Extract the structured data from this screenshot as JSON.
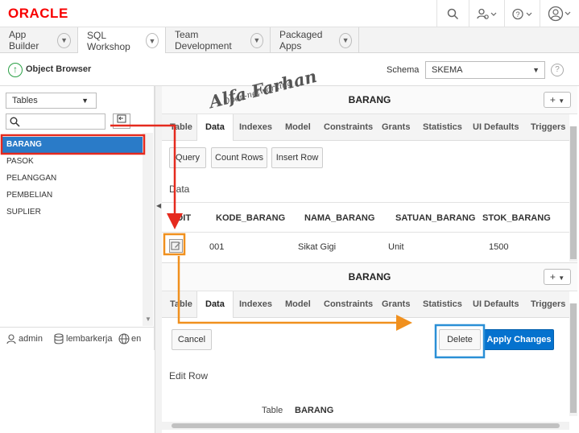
{
  "header": {
    "logo": "ORACLE",
    "icons": [
      "search-icon",
      "user-settings-icon",
      "help-icon",
      "account-icon"
    ]
  },
  "app_tabs": [
    {
      "label": "App Builder",
      "active": false
    },
    {
      "label": "SQL Workshop",
      "active": true
    },
    {
      "label": "Team Development",
      "active": false
    },
    {
      "label": "Packaged Apps",
      "active": false
    }
  ],
  "object_browser": {
    "title": "Object Browser",
    "schema_label": "Schema",
    "schema_value": "SKEMA"
  },
  "left_panel": {
    "object_type": "Tables",
    "search_placeholder": "",
    "tables": [
      "BARANG",
      "PASOK",
      "PELANGGAN",
      "PEMBELIAN",
      "SUPLIER"
    ],
    "selected": "BARANG"
  },
  "footer": {
    "user": "admin",
    "workspace": "lembarkerja",
    "language": "en"
  },
  "watermark": {
    "name": "Alfa Farhan",
    "sub": "Open-networking"
  },
  "top_panel": {
    "title": "BARANG",
    "add_label": "+",
    "tabs": [
      "Table",
      "Data",
      "Indexes",
      "Model",
      "Constraints",
      "Grants",
      "Statistics",
      "UI Defaults",
      "Triggers"
    ],
    "active_tab": "Data",
    "buttons": [
      "Query",
      "Count Rows",
      "Insert Row"
    ],
    "section_label": "Data",
    "columns": [
      "EDIT",
      "KODE_BARANG",
      "NAMA_BARANG",
      "SATUAN_BARANG",
      "STOK_BARANG"
    ],
    "rows": [
      {
        "kode": "001",
        "nama": "Sikat Gigi",
        "satuan": "Unit",
        "stok": "1500"
      }
    ]
  },
  "bottom_panel": {
    "title": "BARANG",
    "add_label": "+",
    "tabs": [
      "Table",
      "Data",
      "Indexes",
      "Model",
      "Constraints",
      "Grants",
      "Statistics",
      "UI Defaults",
      "Triggers"
    ],
    "active_tab": "Data",
    "cancel_label": "Cancel",
    "delete_label": "Delete",
    "apply_label": "Apply Changes",
    "section_label": "Edit Row",
    "table_label": "Table",
    "table_value": "BARANG"
  },
  "colors": {
    "oracle_red": "#f80000",
    "selection_blue": "#2a7bc8",
    "apply_blue": "#0572ce",
    "annotation_red": "#e52a1e",
    "annotation_orange": "#f0901e",
    "annotation_blue": "#2a8fd6"
  }
}
